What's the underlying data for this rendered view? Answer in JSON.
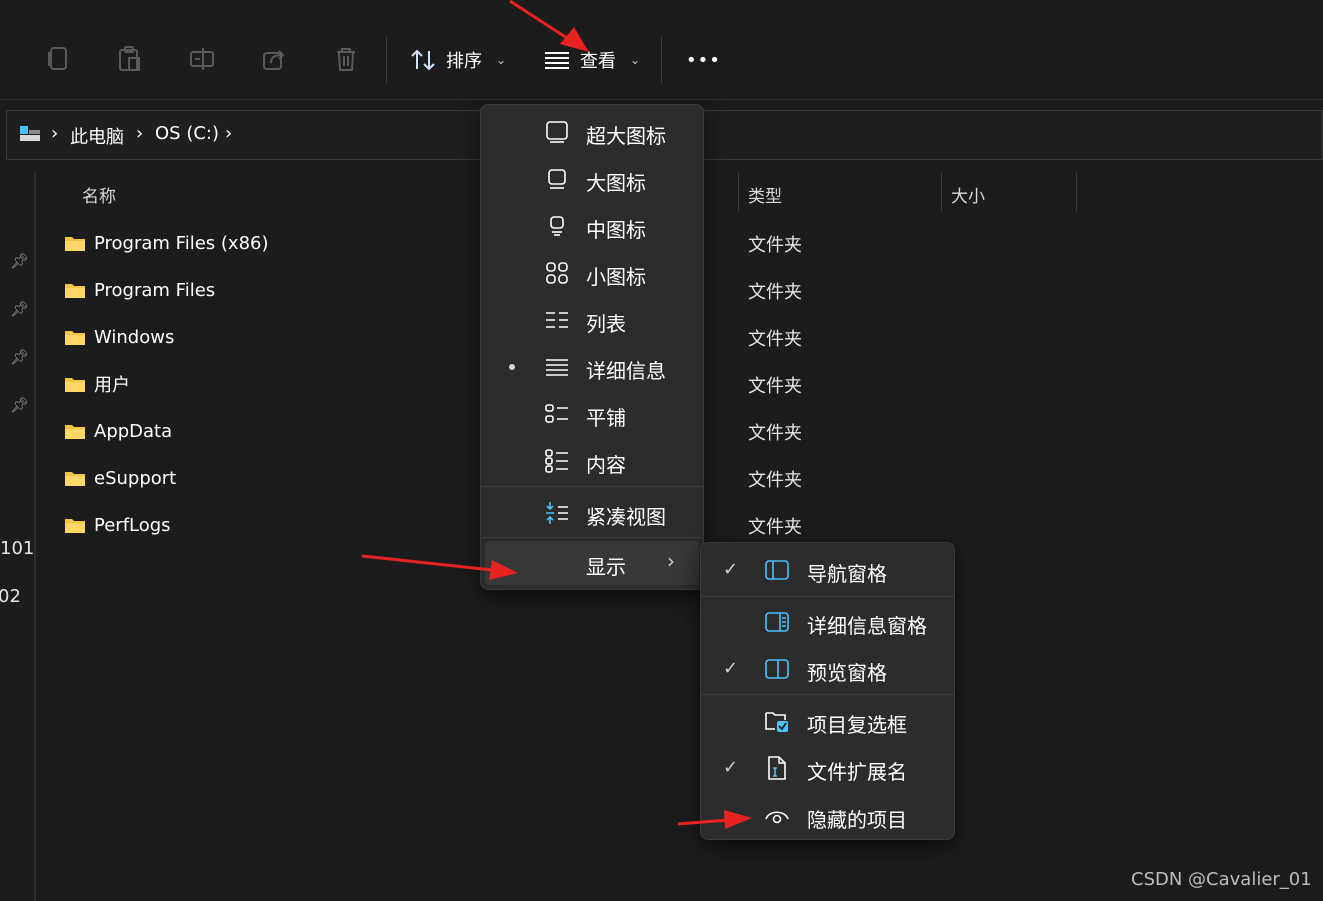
{
  "toolbar": {
    "sort_label": "排序",
    "view_label": "查看",
    "more_label": "•••"
  },
  "address": {
    "crumbs": [
      "此电脑",
      "OS (C:)"
    ],
    "separator": "›"
  },
  "nav": {
    "partial_labels": [
      "101",
      "02"
    ]
  },
  "columns": {
    "name": "名称",
    "type": "类型",
    "size": "大小"
  },
  "files": [
    {
      "name": "Program Files (x86)",
      "type": "文件夹"
    },
    {
      "name": "Program Files",
      "type": "文件夹"
    },
    {
      "name": "Windows",
      "type": "文件夹"
    },
    {
      "name": "用户",
      "type": "文件夹"
    },
    {
      "name": "AppData",
      "type": "文件夹"
    },
    {
      "name": "eSupport",
      "type": "文件夹"
    },
    {
      "name": "PerfLogs",
      "type": "文件夹"
    }
  ],
  "view_menu": {
    "items": [
      {
        "label": "超大图标",
        "icon": "extra-large-icons-icon",
        "selected": false
      },
      {
        "label": "大图标",
        "icon": "large-icons-icon",
        "selected": false
      },
      {
        "label": "中图标",
        "icon": "medium-icons-icon",
        "selected": false
      },
      {
        "label": "小图标",
        "icon": "small-icons-icon",
        "selected": false
      },
      {
        "label": "列表",
        "icon": "list-icon",
        "selected": false
      },
      {
        "label": "详细信息",
        "icon": "details-icon",
        "selected": true
      },
      {
        "label": "平铺",
        "icon": "tiles-icon",
        "selected": false
      },
      {
        "label": "内容",
        "icon": "content-icon",
        "selected": false
      }
    ],
    "compact_label": "紧凑视图",
    "show_label": "显示",
    "show_chevron": "›"
  },
  "show_submenu": {
    "check_glyph": "✓",
    "items": [
      {
        "label": "导航窗格",
        "icon": "navigation-pane-icon",
        "checked": true
      },
      {
        "label": "详细信息窗格",
        "icon": "details-pane-icon",
        "checked": false
      },
      {
        "label": "预览窗格",
        "icon": "preview-pane-icon",
        "checked": true
      },
      {
        "label": "项目复选框",
        "icon": "item-checkboxes-icon",
        "checked": false
      },
      {
        "label": "文件扩展名",
        "icon": "file-extensions-icon",
        "checked": true
      },
      {
        "label": "隐藏的项目",
        "icon": "hidden-items-icon",
        "checked": false
      }
    ]
  },
  "watermark": "CSDN @Cavalier_01",
  "colors": {
    "background": "#1c1c1c",
    "menu_bg": "#2c2c2c",
    "folder": "#f4c542",
    "accent_blue": "#4cc2ff",
    "annotation_arrow": "#e8231f"
  }
}
